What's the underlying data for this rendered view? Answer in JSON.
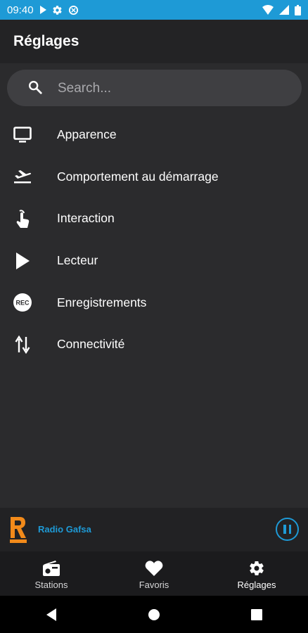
{
  "status_bar": {
    "time": "09:40",
    "icons": [
      "play-icon",
      "gear-icon",
      "sync-icon",
      "wifi-icon",
      "signal-icon",
      "battery-icon"
    ]
  },
  "header": {
    "title": "Réglages"
  },
  "search": {
    "placeholder": "Search..."
  },
  "menu": {
    "items": [
      {
        "label": "Apparence",
        "icon": "monitor-icon"
      },
      {
        "label": "Comportement au démarrage",
        "icon": "plane-takeoff-icon"
      },
      {
        "label": "Interaction",
        "icon": "touch-icon"
      },
      {
        "label": "Lecteur",
        "icon": "play-icon"
      },
      {
        "label": "Enregistrements",
        "icon": "rec-icon"
      },
      {
        "label": "Connectivité",
        "icon": "swap-vertical-icon"
      }
    ]
  },
  "player": {
    "station_name": "Radio Gafsa",
    "state_icon": "pause-icon"
  },
  "bottom_nav": {
    "items": [
      {
        "label": "Stations",
        "icon": "radio-icon"
      },
      {
        "label": "Favoris",
        "icon": "heart-icon"
      },
      {
        "label": "Réglages",
        "icon": "gear-icon",
        "active": true
      }
    ]
  },
  "colors": {
    "accent": "#1e9ad6",
    "background": "#2b2b2d",
    "app_bar": "#232325",
    "search_bg": "#3f3f42",
    "nav_bg": "#1b1b1d"
  }
}
